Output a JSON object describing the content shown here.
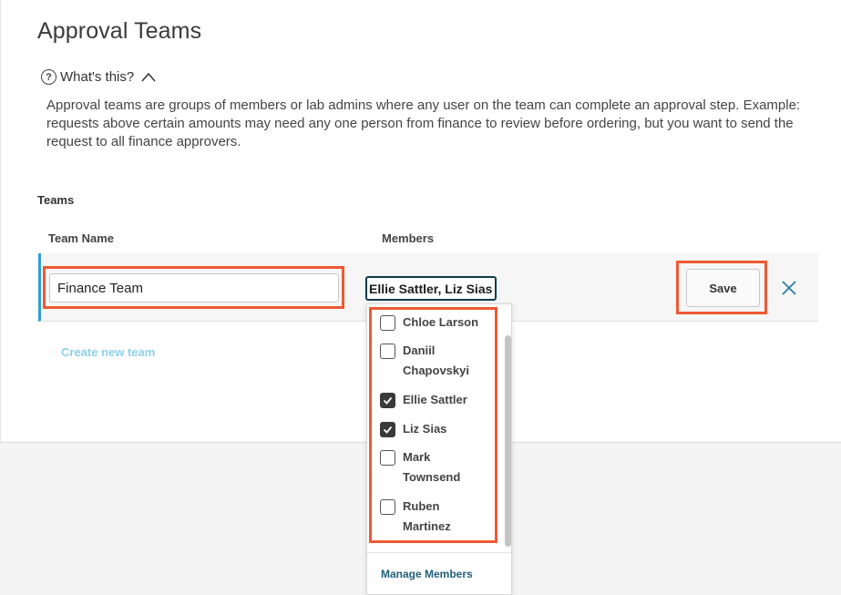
{
  "page": {
    "title": "Approval Teams"
  },
  "help": {
    "label": "What's this?",
    "description": "Approval teams are groups of members or lab admins where any user on the team can complete an approval step. Example: requests above certain amounts may need any one person from finance to review before ordering, but you want to send the request to all finance approvers."
  },
  "teams": {
    "section_label": "Teams",
    "columns": {
      "team_name": "Team Name",
      "members": "Members"
    },
    "row": {
      "name_value": "Finance Team",
      "members_value": "Ellie Sattler, Liz Sias",
      "save_label": "Save"
    },
    "create_label": "Create new team"
  },
  "members_dropdown": {
    "items": [
      {
        "label": "Chloe Larson",
        "checked": false
      },
      {
        "label": "Daniil Chapovskyi",
        "checked": false
      },
      {
        "label": "Ellie Sattler",
        "checked": true
      },
      {
        "label": "Liz Sias",
        "checked": true
      },
      {
        "label": "Mark Townsend",
        "checked": false
      },
      {
        "label": "Ruben Martinez",
        "checked": false
      }
    ],
    "manage_label": "Manage Members"
  },
  "icons": {
    "help": "question-circle-icon",
    "collapse": "chevron-up-icon",
    "close": "close-icon",
    "check": "check-icon"
  },
  "colors": {
    "accent": "#2e9fd4",
    "highlight": "#ee5a33",
    "link": "#8fd0ea",
    "manage_link": "#1f5f7a"
  }
}
